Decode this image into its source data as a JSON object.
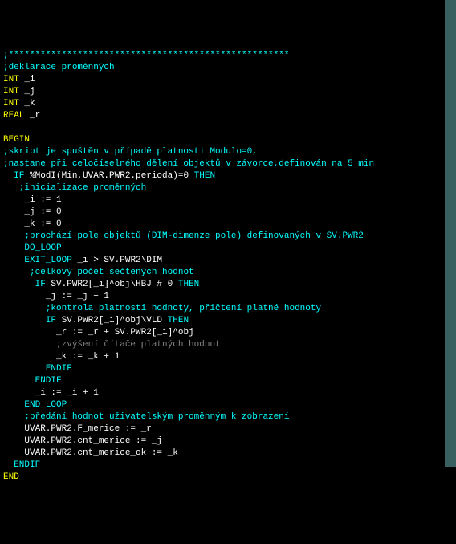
{
  "lines": [
    {
      "indent": 0,
      "segments": [
        {
          "text": ";*****************************************************",
          "cls": "c-teal"
        }
      ]
    },
    {
      "indent": 0,
      "segments": [
        {
          "text": ";deklarace proměnných",
          "cls": "c-teal"
        }
      ]
    },
    {
      "indent": 0,
      "segments": [
        {
          "text": "INT",
          "cls": "c-yellow"
        },
        {
          "text": " _i",
          "cls": "c-white"
        }
      ]
    },
    {
      "indent": 0,
      "segments": [
        {
          "text": "INT",
          "cls": "c-yellow"
        },
        {
          "text": " _j",
          "cls": "c-white"
        }
      ]
    },
    {
      "indent": 0,
      "segments": [
        {
          "text": "INT",
          "cls": "c-yellow"
        },
        {
          "text": " _k",
          "cls": "c-white"
        }
      ]
    },
    {
      "indent": 0,
      "segments": [
        {
          "text": "REAL",
          "cls": "c-yellow"
        },
        {
          "text": " _r",
          "cls": "c-white"
        }
      ]
    },
    {
      "indent": 0,
      "segments": [
        {
          "text": " ",
          "cls": "c-white"
        }
      ]
    },
    {
      "indent": 0,
      "segments": [
        {
          "text": "BEGIN",
          "cls": "c-yellow"
        }
      ]
    },
    {
      "indent": 0,
      "segments": [
        {
          "text": ";skript je spuštěn v případě platnosti Modulo=0,",
          "cls": "c-teal"
        }
      ]
    },
    {
      "indent": 0,
      "segments": [
        {
          "text": ";nastane při celočíselného dělení objektů v závorce,definován na 5 min",
          "cls": "c-teal"
        }
      ]
    },
    {
      "indent": 1,
      "segments": [
        {
          "text": "IF",
          "cls": "c-teal"
        },
        {
          "text": " %ModI(Min,UVAR.PWR2.perioda)=0 ",
          "cls": "c-white"
        },
        {
          "text": "THEN",
          "cls": "c-teal"
        }
      ]
    },
    {
      "indent": 1,
      "segments": [
        {
          "text": " ;inicializace proměnných",
          "cls": "c-teal"
        }
      ]
    },
    {
      "indent": 2,
      "segments": [
        {
          "text": "_i := 1",
          "cls": "c-white"
        }
      ]
    },
    {
      "indent": 2,
      "segments": [
        {
          "text": "_j := 0",
          "cls": "c-white"
        }
      ]
    },
    {
      "indent": 2,
      "segments": [
        {
          "text": "_k := 0",
          "cls": "c-white"
        }
      ]
    },
    {
      "indent": 2,
      "segments": [
        {
          "text": ";prochází pole objektů (DIM-dimenze pole) definovaných v SV.PWR2",
          "cls": "c-teal"
        }
      ]
    },
    {
      "indent": 2,
      "segments": [
        {
          "text": "DO_LOOP",
          "cls": "c-teal"
        }
      ]
    },
    {
      "indent": 2,
      "segments": [
        {
          "text": "EXIT_LOOP",
          "cls": "c-teal"
        },
        {
          "text": " _i > SV.PWR2\\DIM",
          "cls": "c-white"
        }
      ]
    },
    {
      "indent": 2,
      "segments": [
        {
          "text": " ;celkový počet sečtených hodnot",
          "cls": "c-teal"
        }
      ]
    },
    {
      "indent": 3,
      "segments": [
        {
          "text": "IF",
          "cls": "c-teal"
        },
        {
          "text": " SV.PWR2[_i]^obj\\HBJ # 0 ",
          "cls": "c-white"
        },
        {
          "text": "THEN",
          "cls": "c-teal"
        }
      ]
    },
    {
      "indent": 4,
      "segments": [
        {
          "text": "_j := _j + 1",
          "cls": "c-white"
        }
      ]
    },
    {
      "indent": 4,
      "segments": [
        {
          "text": ";kontrola platnosti hodnoty, přičtení platné hodnoty",
          "cls": "c-teal"
        }
      ]
    },
    {
      "indent": 4,
      "segments": [
        {
          "text": "IF",
          "cls": "c-teal"
        },
        {
          "text": " SV.PWR2[_i]^obj\\VLD ",
          "cls": "c-white"
        },
        {
          "text": "THEN",
          "cls": "c-teal"
        }
      ]
    },
    {
      "indent": 5,
      "segments": [
        {
          "text": "_r := _r + SV.PWR2[_i]^obj",
          "cls": "c-white"
        }
      ]
    },
    {
      "indent": 5,
      "segments": [
        {
          "text": ";zvýšení čítače platných hodnot",
          "cls": "c-gray"
        }
      ]
    },
    {
      "indent": 5,
      "segments": [
        {
          "text": "_k := _k + 1",
          "cls": "c-white"
        }
      ]
    },
    {
      "indent": 4,
      "segments": [
        {
          "text": "ENDIF",
          "cls": "c-teal"
        }
      ]
    },
    {
      "indent": 3,
      "segments": [
        {
          "text": "ENDIF",
          "cls": "c-teal"
        }
      ]
    },
    {
      "indent": 3,
      "segments": [
        {
          "text": "_i := _i + 1",
          "cls": "c-white"
        }
      ]
    },
    {
      "indent": 2,
      "segments": [
        {
          "text": "END_LOOP",
          "cls": "c-teal"
        }
      ]
    },
    {
      "indent": 2,
      "segments": [
        {
          "text": ";předání hodnot uživatelským proměnným k zobrazení",
          "cls": "c-teal"
        }
      ]
    },
    {
      "indent": 2,
      "segments": [
        {
          "text": "UVAR.PWR2.F_merice := _r",
          "cls": "c-white"
        }
      ]
    },
    {
      "indent": 2,
      "segments": [
        {
          "text": "UVAR.PWR2.cnt_merice := _j",
          "cls": "c-white"
        }
      ]
    },
    {
      "indent": 2,
      "segments": [
        {
          "text": "UVAR.PWR2.cnt_merice_ok := _k",
          "cls": "c-white"
        }
      ]
    },
    {
      "indent": 1,
      "segments": [
        {
          "text": "ENDIF",
          "cls": "c-teal"
        }
      ]
    },
    {
      "indent": 0,
      "segments": [
        {
          "text": "END",
          "cls": "c-yellow"
        }
      ]
    }
  ]
}
